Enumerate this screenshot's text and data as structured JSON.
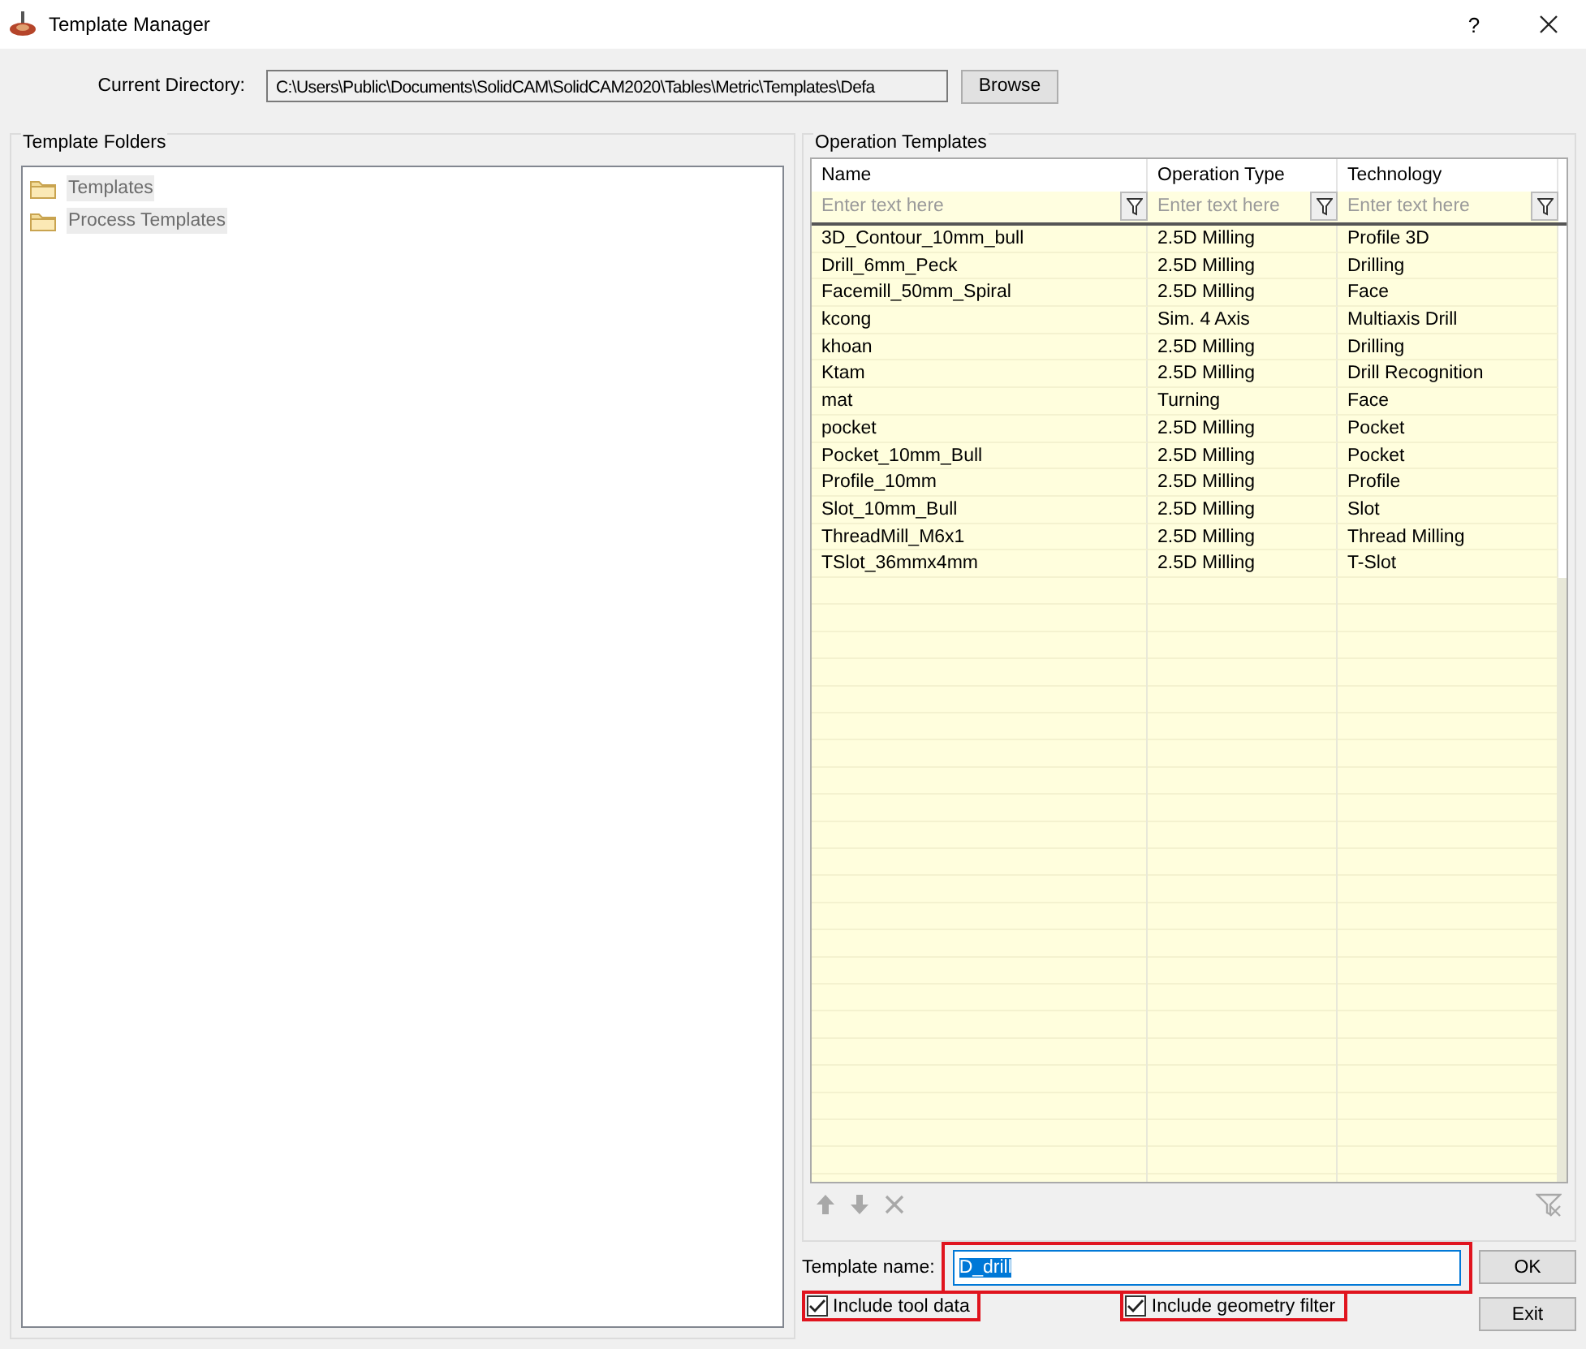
{
  "window": {
    "title": "Template Manager",
    "help": "?"
  },
  "current_directory": {
    "label": "Current Directory:",
    "value": "C:\\Users\\Public\\Documents\\SolidCAM\\SolidCAM2020\\Tables\\Metric\\Templates\\Defa",
    "button": "Browse"
  },
  "template_folders": {
    "title": "Template Folders",
    "items": [
      {
        "label": "Templates"
      },
      {
        "label": "Process Templates"
      }
    ]
  },
  "operation_templates": {
    "title": "Operation Templates",
    "columns": [
      {
        "label": "Name",
        "placeholder": "Enter text here"
      },
      {
        "label": "Operation Type",
        "placeholder": "Enter text here"
      },
      {
        "label": "Technology",
        "placeholder": "Enter text here"
      }
    ],
    "rows": [
      [
        "3D_Contour_10mm_bull",
        "2.5D Milling",
        "Profile 3D"
      ],
      [
        "Drill_6mm_Peck",
        "2.5D Milling",
        "Drilling"
      ],
      [
        "Facemill_50mm_Spiral",
        "2.5D Milling",
        "Face"
      ],
      [
        "kcong",
        "Sim. 4 Axis",
        "Multiaxis Drill"
      ],
      [
        "khoan",
        "2.5D Milling",
        "Drilling"
      ],
      [
        "Ktam",
        "2.5D Milling",
        "Drill Recognition"
      ],
      [
        "mat",
        "Turning",
        "Face"
      ],
      [
        "pocket",
        "2.5D Milling",
        "Pocket"
      ],
      [
        "Pocket_10mm_Bull",
        "2.5D Milling",
        "Pocket"
      ],
      [
        "Profile_10mm",
        "2.5D Milling",
        "Profile"
      ],
      [
        "Slot_10mm_Bull",
        "2.5D Milling",
        "Slot"
      ],
      [
        "ThreadMill_M6x1",
        "2.5D Milling",
        "Thread Milling"
      ],
      [
        "TSlot_36mmx4mm",
        "2.5D Milling",
        "T-Slot"
      ]
    ]
  },
  "template_name": {
    "label": "Template name:",
    "value": "D_drill",
    "value_selected": true,
    "highlighted": true
  },
  "options": [
    {
      "label": "Include tool data",
      "checked": true,
      "highlighted": true
    },
    {
      "label": "Include geometry filter",
      "checked": true,
      "highlighted": true
    }
  ],
  "buttons": [
    "OK",
    "Exit"
  ]
}
